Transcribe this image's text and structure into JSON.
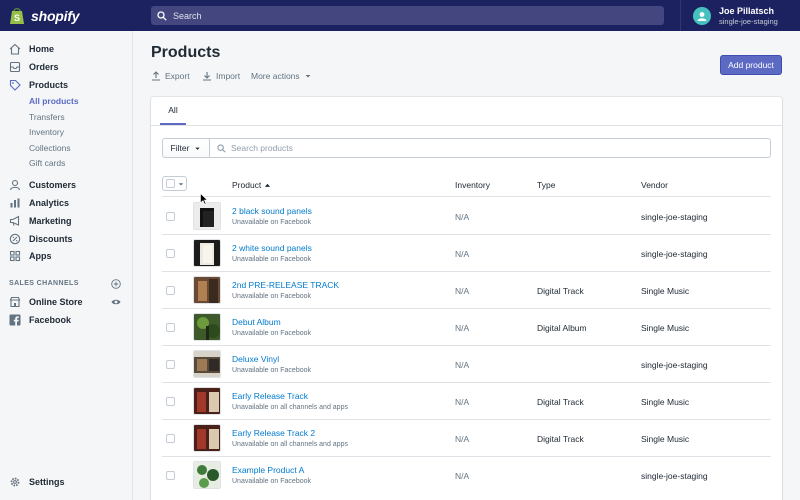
{
  "topbar": {
    "brand": "shopify",
    "search_placeholder": "Search",
    "user_name": "Joe Pillatsch",
    "user_store": "single-joe-staging"
  },
  "sidebar": {
    "items": [
      {
        "label": "Home",
        "icon": "home-icon"
      },
      {
        "label": "Orders",
        "icon": "orders-icon"
      },
      {
        "label": "Products",
        "icon": "tag-icon"
      },
      {
        "label": "Customers",
        "icon": "person-icon"
      },
      {
        "label": "Analytics",
        "icon": "bar-chart-icon"
      },
      {
        "label": "Marketing",
        "icon": "megaphone-icon"
      },
      {
        "label": "Discounts",
        "icon": "discount-icon"
      },
      {
        "label": "Apps",
        "icon": "apps-icon"
      }
    ],
    "product_subitems": [
      "All products",
      "Transfers",
      "Inventory",
      "Collections",
      "Gift cards"
    ],
    "sales_channels_title": "SALES CHANNELS",
    "channels": [
      {
        "label": "Online Store",
        "icon": "store-icon"
      },
      {
        "label": "Facebook",
        "icon": "facebook-icon"
      }
    ],
    "settings_label": "Settings"
  },
  "main": {
    "title": "Products",
    "actions": {
      "export": "Export",
      "import": "Import",
      "more": "More actions"
    },
    "add_product": "Add product",
    "tab_all": "All",
    "filter_label": "Filter",
    "search_placeholder": "Search products",
    "columns": {
      "product": "Product",
      "inventory": "Inventory",
      "type": "Type",
      "vendor": "Vendor"
    },
    "products": [
      {
        "name": "2 black sound panels",
        "availability": "Unavailable on Facebook",
        "inventory": "N/A",
        "type": "",
        "vendor": "single-joe-staging"
      },
      {
        "name": "2 white sound panels",
        "availability": "Unavailable on Facebook",
        "inventory": "N/A",
        "type": "",
        "vendor": "single-joe-staging"
      },
      {
        "name": "2nd PRE-RELEASE TRACK",
        "availability": "Unavailable on Facebook",
        "inventory": "N/A",
        "type": "Digital Track",
        "vendor": "Single Music"
      },
      {
        "name": "Debut Album",
        "availability": "Unavailable on Facebook",
        "inventory": "N/A",
        "type": "Digital Album",
        "vendor": "Single Music"
      },
      {
        "name": "Deluxe Vinyl",
        "availability": "Unavailable on Facebook",
        "inventory": "N/A",
        "type": "",
        "vendor": "single-joe-staging"
      },
      {
        "name": "Early Release Track",
        "availability": "Unavailable on all channels and apps",
        "inventory": "N/A",
        "type": "Digital Track",
        "vendor": "Single Music"
      },
      {
        "name": "Early Release Track 2",
        "availability": "Unavailable on all channels and apps",
        "inventory": "N/A",
        "type": "Digital Track",
        "vendor": "Single Music"
      },
      {
        "name": "Example Product A",
        "availability": "Unavailable on Facebook",
        "inventory": "N/A",
        "type": "",
        "vendor": "single-joe-staging"
      }
    ]
  },
  "colors": {
    "topbar": "#1c2260",
    "accent": "#5c6ac4",
    "link": "#007ace"
  }
}
